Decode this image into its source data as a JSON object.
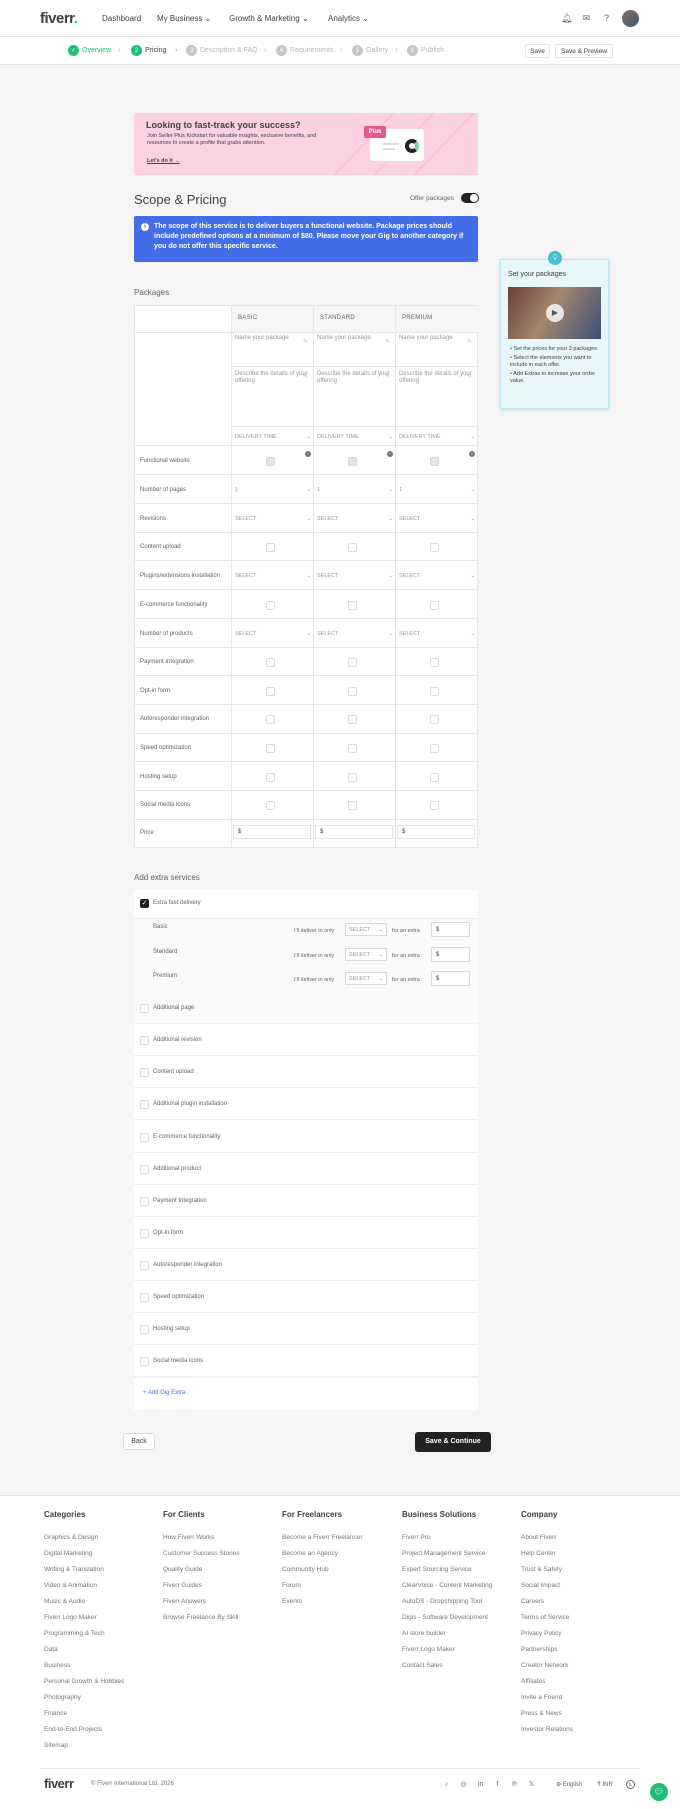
{
  "header": {
    "logo": "fiverr",
    "logo_dot": ".",
    "nav": [
      "Dashboard",
      "My Business",
      "Growth & Marketing",
      "Analytics"
    ]
  },
  "stepper": {
    "steps": [
      {
        "num": "✓",
        "label": "Overview"
      },
      {
        "num": "2",
        "label": "Pricing"
      },
      {
        "num": "3",
        "label": "Description & FAQ"
      },
      {
        "num": "4",
        "label": "Requirements"
      },
      {
        "num": "5",
        "label": "Gallery"
      },
      {
        "num": "6",
        "label": "Publish"
      }
    ],
    "save_label": "Save",
    "save_preview_label": "Save & Preview"
  },
  "banner": {
    "title": "Looking to fast-track your success?",
    "desc": "Join Seller Plus Kickstart for valuable insights, exclusive benefits, and resources to create a profile that grabs attention.",
    "link": "Let's do it →",
    "badge": "Plus"
  },
  "scope": {
    "title": "Scope & Pricing",
    "offer_packages": "Offer packages",
    "info": "The scope of this service is to deliver buyers a functional website. Package prices should include predefined options at a minimum of $80. Please move your Gig to another category if you do not offer this specific service."
  },
  "packages": {
    "title": "Packages",
    "columns": [
      "BASIC",
      "STANDARD",
      "PREMIUM"
    ],
    "name_placeholder": "Name your package",
    "desc_placeholder": "Describe the details of your offering",
    "delivery": "DELIVERY TIME",
    "rows": {
      "functional": "Functional website",
      "pages": "Number of pages",
      "pages_value": "1",
      "revisions": "Revisions",
      "content": "Content upload",
      "plugins": "Plugins/extensions installation",
      "ecommerce": "E-commerce functionality",
      "products": "Number of products",
      "payment": "Payment Integration",
      "optin": "Opt-in form",
      "autoresponder": "Autoresponder integration",
      "speed": "Speed optimization",
      "hosting": "Hosting setup",
      "social": "Social media icons",
      "price": "Price"
    },
    "select": "SELECT",
    "currency": "$"
  },
  "tooltip": {
    "title": "Set your packages",
    "items": [
      "Set the prices for your 3 packages.",
      "Select the elements you want to include in each offer.",
      "Add Extras to increase your order value."
    ]
  },
  "extras": {
    "title": "Add extra services",
    "fast_delivery": "Extra fast delivery",
    "tiers": [
      "Basic",
      "Standard",
      "Premium"
    ],
    "deliver_in": "I'll deliver in only",
    "for_extra": "for an extra",
    "select": "SELECT",
    "currency": "$",
    "items": [
      "Additional page",
      "Additional revision",
      "Content upload",
      "Additional plugin installation",
      "E-commerce functionality",
      "Additional product",
      "Payment Integration",
      "Opt-in form",
      "Autoresponder integration",
      "Speed optimization",
      "Hosting setup",
      "Social media icons"
    ],
    "add_gig_extra": "Add Gig Extra"
  },
  "actions": {
    "back": "Back",
    "save_continue": "Save & Continue"
  },
  "footer": {
    "columns": [
      {
        "title": "Categories",
        "links": [
          "Graphics & Design",
          "Digital Marketing",
          "Writing & Translation",
          "Video & Animation",
          "Music & Audio",
          "Fiverr Logo Maker",
          "Programming & Tech",
          "Data",
          "Business",
          "Personal Growth & Hobbies",
          "Photography",
          "Finance",
          "End-to-End Projects",
          "Sitemap"
        ]
      },
      {
        "title": "For Clients",
        "links": [
          "How Fiverr Works",
          "Customer Success Stories",
          "Quality Guide",
          "Fiverr Guides",
          "Fiverr Answers",
          "Browse Freelance By Skill"
        ]
      },
      {
        "title": "For Freelancers",
        "links": [
          "Become a Fiverr Freelancer",
          "Become an Agency",
          "Community Hub",
          "Forum",
          "Events"
        ]
      },
      {
        "title": "Business Solutions",
        "links": [
          "Fiverr Pro",
          "Project Management Service",
          "Expert Sourcing Service",
          "ClearVoice - Content Marketing",
          "AutoDS - Dropshipping Tool",
          "Digis - Software Development",
          "AI store builder",
          "Fiverr Logo Maker",
          "Contact Sales"
        ]
      },
      {
        "title": "Company",
        "links": [
          "About Fiverr",
          "Help Center",
          "Trust & Safety",
          "Social Impact",
          "Careers",
          "Terms of Service",
          "Privacy Policy",
          "Partnerships",
          "Creator Network",
          "Affiliates",
          "Invite a Friend",
          "Press & News",
          "Investor Relations"
        ]
      }
    ],
    "logo": "fiverr",
    "copyright": "© Fiverr International Ltd. 2026",
    "language": "English",
    "currency": "₹ INR"
  }
}
